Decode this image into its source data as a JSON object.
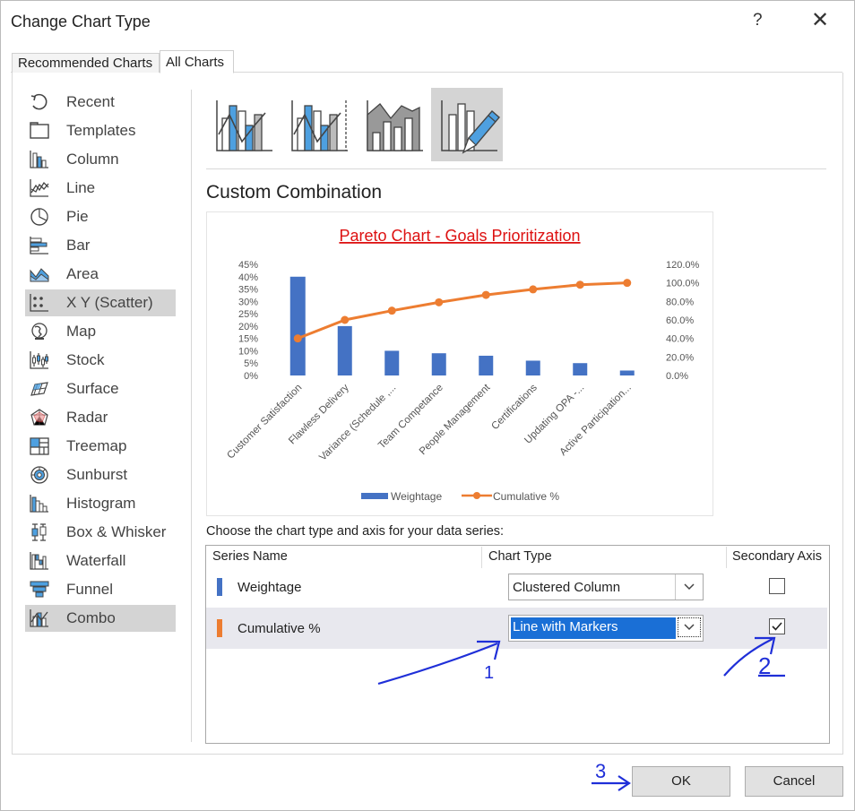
{
  "window": {
    "title": "Change Chart Type",
    "help": "?",
    "close": "✕"
  },
  "tabs": [
    {
      "label": "Recommended Charts"
    },
    {
      "label": "All Charts"
    }
  ],
  "chart_types": [
    {
      "label": "Recent",
      "icon": "recent-icon"
    },
    {
      "label": "Templates",
      "icon": "templates-icon"
    },
    {
      "label": "Column",
      "icon": "column-chart-icon"
    },
    {
      "label": "Line",
      "icon": "line-chart-icon"
    },
    {
      "label": "Pie",
      "icon": "pie-chart-icon"
    },
    {
      "label": "Bar",
      "icon": "bar-chart-icon"
    },
    {
      "label": "Area",
      "icon": "area-chart-icon"
    },
    {
      "label": "X Y (Scatter)",
      "icon": "scatter-chart-icon"
    },
    {
      "label": "Map",
      "icon": "map-chart-icon"
    },
    {
      "label": "Stock",
      "icon": "stock-chart-icon"
    },
    {
      "label": "Surface",
      "icon": "surface-chart-icon"
    },
    {
      "label": "Radar",
      "icon": "radar-chart-icon"
    },
    {
      "label": "Treemap",
      "icon": "treemap-chart-icon"
    },
    {
      "label": "Sunburst",
      "icon": "sunburst-chart-icon"
    },
    {
      "label": "Histogram",
      "icon": "histogram-chart-icon"
    },
    {
      "label": "Box & Whisker",
      "icon": "box-whisker-chart-icon"
    },
    {
      "label": "Waterfall",
      "icon": "waterfall-chart-icon"
    },
    {
      "label": "Funnel",
      "icon": "funnel-chart-icon"
    },
    {
      "label": "Combo",
      "icon": "combo-chart-icon"
    }
  ],
  "highlighted_items": [
    "X Y (Scatter)",
    "Combo"
  ],
  "combo_subtypes": [
    {
      "icon": "clustered-column-line-icon"
    },
    {
      "icon": "clustered-column-line-secondary-icon"
    },
    {
      "icon": "stacked-area-clustered-column-icon"
    },
    {
      "icon": "custom-combination-icon",
      "selected": true
    }
  ],
  "section_title": "Custom Combination",
  "chart_data": {
    "type": "bar",
    "title": "Pareto Chart - Goals Prioritization",
    "categories": [
      "Customer Satisfaction",
      "Flawless Delivery",
      "Variance (Schedule ,...",
      "Team Competance",
      "People Management",
      "Certifications",
      "Updating OPA -...",
      "Active Participation..."
    ],
    "y_ticks": [
      "45%",
      "40%",
      "35%",
      "30%",
      "25%",
      "20%",
      "15%",
      "10%",
      "5%",
      "0%"
    ],
    "y2_ticks": [
      "120.0%",
      "100.0%",
      "80.0%",
      "60.0%",
      "40.0%",
      "20.0%",
      "0.0%"
    ],
    "ylim": [
      0,
      45
    ],
    "y2lim": [
      0,
      120
    ],
    "series": [
      {
        "name": "Weightage",
        "type": "column",
        "axis": "primary",
        "color": "#4472c4",
        "values": [
          40,
          20,
          10,
          9,
          8,
          6,
          5,
          2
        ]
      },
      {
        "name": "Cumulative %",
        "type": "line",
        "axis": "secondary",
        "color": "#ed7d31",
        "values": [
          40,
          60,
          70,
          79,
          87,
          93,
          98,
          100
        ]
      }
    ],
    "legend": "bottom",
    "grid": false
  },
  "series_section": {
    "prompt": "Choose the chart type and axis for your data series:",
    "headers": {
      "name": "Series Name",
      "type": "Chart Type",
      "secondary": "Secondary Axis"
    },
    "rows": [
      {
        "name": "Weightage",
        "color": "#4472c4",
        "chart_type": "Clustered Column",
        "secondary_axis": false
      },
      {
        "name": "Cumulative %",
        "color": "#ed7d31",
        "chart_type": "Line with Markers",
        "secondary_axis": true
      }
    ]
  },
  "annotations": {
    "arrow1_label": "1",
    "arrow2_label": "2",
    "arrow3_label": "3"
  },
  "buttons": {
    "ok": "OK",
    "cancel": "Cancel"
  }
}
